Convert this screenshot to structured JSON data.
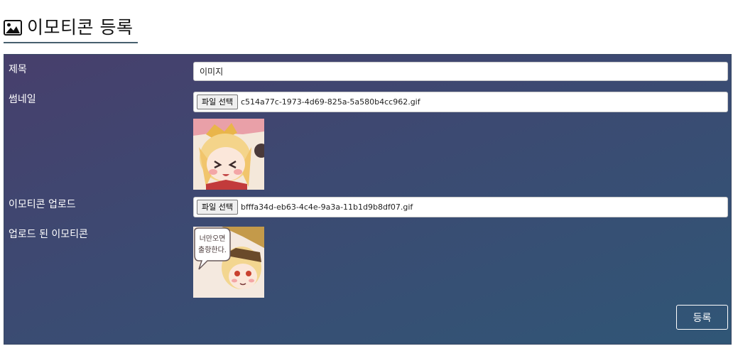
{
  "page": {
    "title": "이모티콘 등록",
    "title_icon": "image-icon"
  },
  "form": {
    "title_label": "제목",
    "title_value": "이미지",
    "thumbnail_label": "썸네일",
    "thumbnail_file_button": "파일 선택",
    "thumbnail_file_name": "c514a77c-1973-4d69-825a-5a580b4cc962.gif",
    "emoticon_label": "이모티콘 업로드",
    "emoticon_file_button": "파일 선택",
    "emoticon_file_name": "bfffa34d-eb63-4c4e-9a3a-11b1d9b8df07.gif",
    "uploaded_label": "업로드 된 이모티콘",
    "uploaded_image_text": "너만오면 출항한다.",
    "submit_label": "등록"
  },
  "colors": {
    "panel_gradient_start": "#473f6c",
    "panel_gradient_end": "#305676",
    "title_underline": "#47606e"
  }
}
